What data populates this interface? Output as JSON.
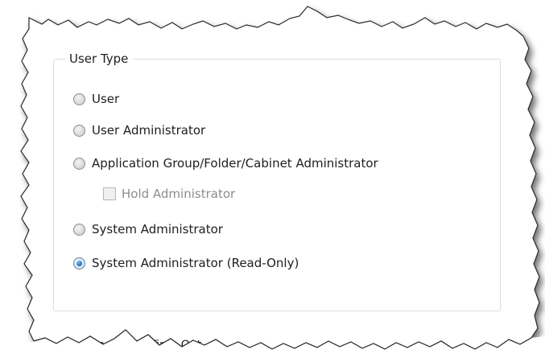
{
  "user_type": {
    "legend": "User Type",
    "options": [
      {
        "label": "User",
        "selected": false
      },
      {
        "label": "User Administrator",
        "selected": false
      },
      {
        "label": "Application Group/Folder/Cabinet Administrator",
        "selected": false
      },
      {
        "label": "System Administrator",
        "selected": false
      },
      {
        "label": "System Administrator (Read-Only)",
        "selected": true
      }
    ],
    "hold_admin": {
      "label": "Hold Administrator",
      "checked": false,
      "enabled": false
    }
  },
  "next_section": {
    "legend_partial": "Inactivity Time Out"
  }
}
